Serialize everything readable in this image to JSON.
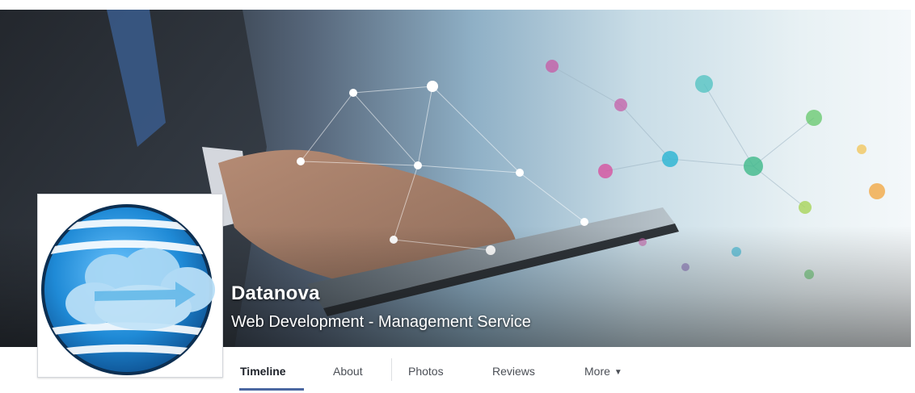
{
  "page": {
    "name": "Datanova",
    "category": "Web Development - Management Service"
  },
  "tabs": [
    {
      "label": "Timeline",
      "active": true
    },
    {
      "label": "About",
      "active": false
    },
    {
      "label": "Photos",
      "active": false
    },
    {
      "label": "Reviews",
      "active": false
    },
    {
      "label": "More",
      "active": false
    }
  ],
  "icons": {
    "more_dropdown": "caret-down-icon",
    "logo": "globe-cloud-icon"
  },
  "colors": {
    "tab_underline": "#4b67a1",
    "name_text": "#ffffff",
    "logo_blue": "#1f8ad6"
  }
}
